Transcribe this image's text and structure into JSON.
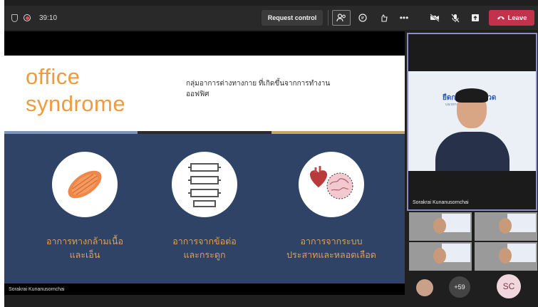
{
  "toolbar": {
    "timer": "39:10",
    "request_control": "Request control",
    "leave": "Leave",
    "icons": [
      "shield-icon",
      "record-icon",
      "people-icon",
      "chat-icon",
      "reactions-icon",
      "more-icon",
      "camera-off-icon",
      "mic-off-icon",
      "share-icon",
      "phone-icon"
    ]
  },
  "slide": {
    "title_line1": "office",
    "title_line2": "syndrome",
    "subtitle": "กลุ่มอาการต่างทางกาย ที่เกิดขึ้นจากการทำงานออฟฟิศ",
    "captions": [
      [
        "อาการทางกล้ามเนื้อ",
        "และเอ็น"
      ],
      [
        "อาการจากข้อต่อ",
        "และกระดูก"
      ],
      [
        "อาการจากระบบ",
        "ประสาทและหลอดเลือด"
      ]
    ],
    "icons": [
      "muscle-icon",
      "spine-icon",
      "heart-brain-icon"
    ],
    "presenter": "Sorakrai Kunanusornchai"
  },
  "participants": {
    "main_name": "Sorakrai Kunanusornchai",
    "banner": "ยืดกาย คลายปวด",
    "banner_sub": "แนวทางการดูแลตนเอง",
    "overflow": "+59",
    "self_initials": "SC"
  },
  "colors": {
    "accent": "#f09a3e",
    "slide_bg": "#2e4366",
    "leave": "#c4314b"
  }
}
